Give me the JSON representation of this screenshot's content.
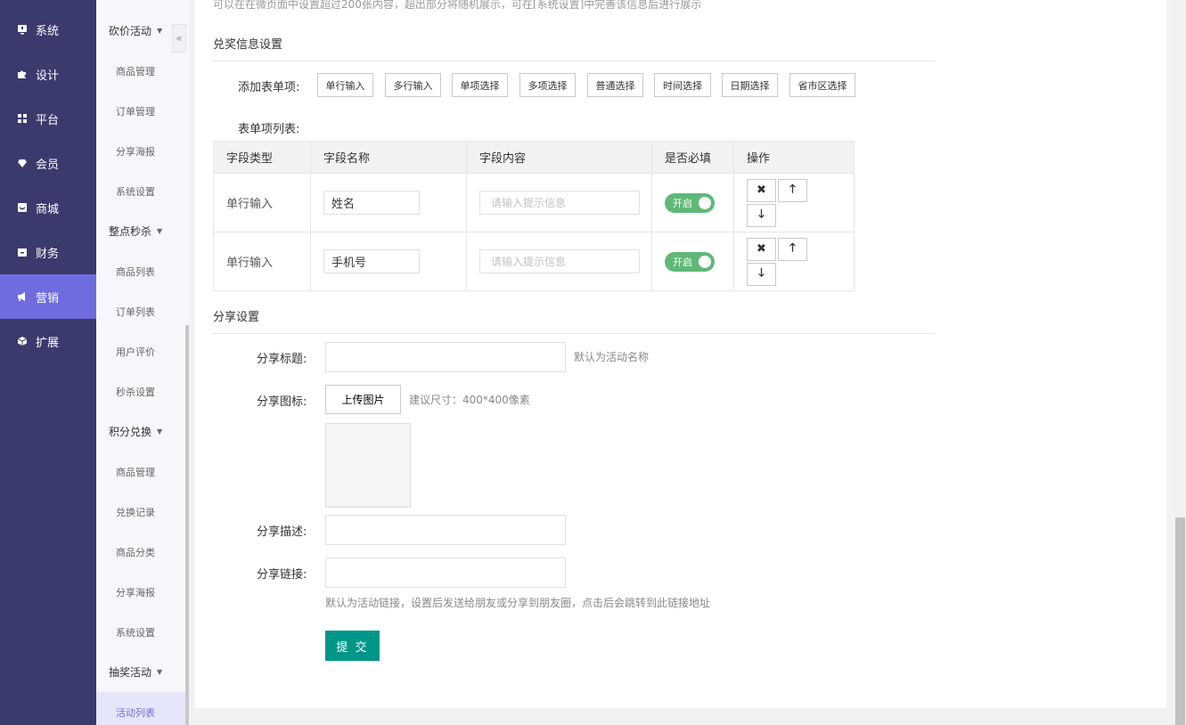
{
  "nav_primary": [
    {
      "label": "系统",
      "icon": "monitor-icon",
      "active": false
    },
    {
      "label": "设计",
      "icon": "puzzle-icon",
      "active": false
    },
    {
      "label": "平台",
      "icon": "grid-icon",
      "active": false
    },
    {
      "label": "会员",
      "icon": "diamond-icon",
      "active": false
    },
    {
      "label": "商城",
      "icon": "inbox-icon",
      "active": false
    },
    {
      "label": "财务",
      "icon": "calendar-icon",
      "active": false
    },
    {
      "label": "营销",
      "icon": "megaphone-icon",
      "active": true
    },
    {
      "label": "扩展",
      "icon": "cube-icon",
      "active": false
    }
  ],
  "nav_secondary": {
    "groups": [
      {
        "title": "砍价活动",
        "items": [
          "商品管理",
          "订单管理",
          "分享海报",
          "系统设置"
        ]
      },
      {
        "title": "整点秒杀",
        "items": [
          "商品列表",
          "订单列表",
          "用户评价",
          "秒杀设置"
        ]
      },
      {
        "title": "积分兑换",
        "items": [
          "商品管理",
          "兑换记录",
          "商品分类",
          "分享海报",
          "系统设置"
        ]
      },
      {
        "title": "抽奖活动",
        "items": [
          "活动列表"
        ]
      }
    ],
    "active_item": "活动列表",
    "collapse_icon": "double-chevron-left-icon"
  },
  "top_note": "可以在在微页面中设置超过200张内容，超出部分将随机展示，可在[系统设置]中完善该信息后进行展示",
  "prize_section": {
    "title": "兑奖信息设置",
    "add_label": "添加表单项:",
    "add_buttons": [
      "单行输入",
      "多行输入",
      "单项选择",
      "多项选择",
      "普通选择",
      "时间选择",
      "日期选择",
      "省市区选择"
    ],
    "list_label": "表单项列表:",
    "table": {
      "headers": [
        "字段类型",
        "字段名称",
        "字段内容",
        "是否必填",
        "操作"
      ],
      "rows": [
        {
          "type": "单行输入",
          "name": "姓名",
          "content_placeholder": "请输入提示信息",
          "required": "开启"
        },
        {
          "type": "单行输入",
          "name": "手机号",
          "content_placeholder": "请输入提示信息",
          "required": "开启"
        }
      ],
      "op_icons": [
        "close-icon",
        "arrow-up-icon",
        "arrow-down-icon"
      ]
    }
  },
  "share_section": {
    "title": "分享设置",
    "title_label": "分享标题:",
    "title_hint": "默认为活动名称",
    "icon_label": "分享图标:",
    "upload_label": "上传图片",
    "icon_hint": "建议尺寸：400*400像素",
    "desc_label": "分享描述:",
    "link_label": "分享链接:",
    "link_hint": "默认为活动链接，设置后发送给朋友或分享到朋友圈，点击后会跳转到此链接地址",
    "submit_label": "提 交"
  },
  "colors": {
    "nav_bg": "#3b3a6d",
    "nav_active": "#6f6ce0",
    "toggle_on": "#5fb878",
    "submit": "#009688"
  }
}
